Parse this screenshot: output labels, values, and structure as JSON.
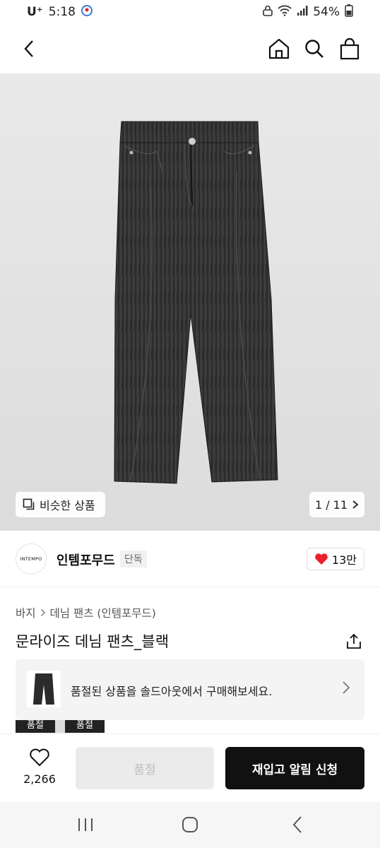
{
  "status_bar": {
    "carrier": "U⁺",
    "time": "5:18",
    "battery": "54%",
    "icons": [
      "location-icon",
      "lock-icon",
      "wifi-icon",
      "signal-icon",
      "battery-icon"
    ]
  },
  "header": {
    "icons": [
      "back-icon",
      "home-icon",
      "search-icon",
      "shopping-bag-icon"
    ]
  },
  "hero": {
    "similar_label": "비슷한 상품",
    "pager": "1 / 11"
  },
  "brand": {
    "logo_text": "INTEMPO",
    "name": "인템포무드",
    "badge": "단독",
    "likes": "13만"
  },
  "product": {
    "breadcrumb": [
      "바지",
      "데님 팬츠 (인템포무드)"
    ],
    "title": "문라이즈 데님 팬츠_블랙"
  },
  "soldout_banner": {
    "text": "품절된 상품을 솔드아웃에서 구매해보세요."
  },
  "tags": [
    "품절",
    "품절"
  ],
  "action_bar": {
    "wish_count": "2,266",
    "soldout_label": "품절",
    "restock_label": "재입고 알림 신청"
  },
  "colors": {
    "accent_black": "#111111",
    "heart_red": "#e8212b",
    "disabled_bg": "#ebebeb"
  }
}
